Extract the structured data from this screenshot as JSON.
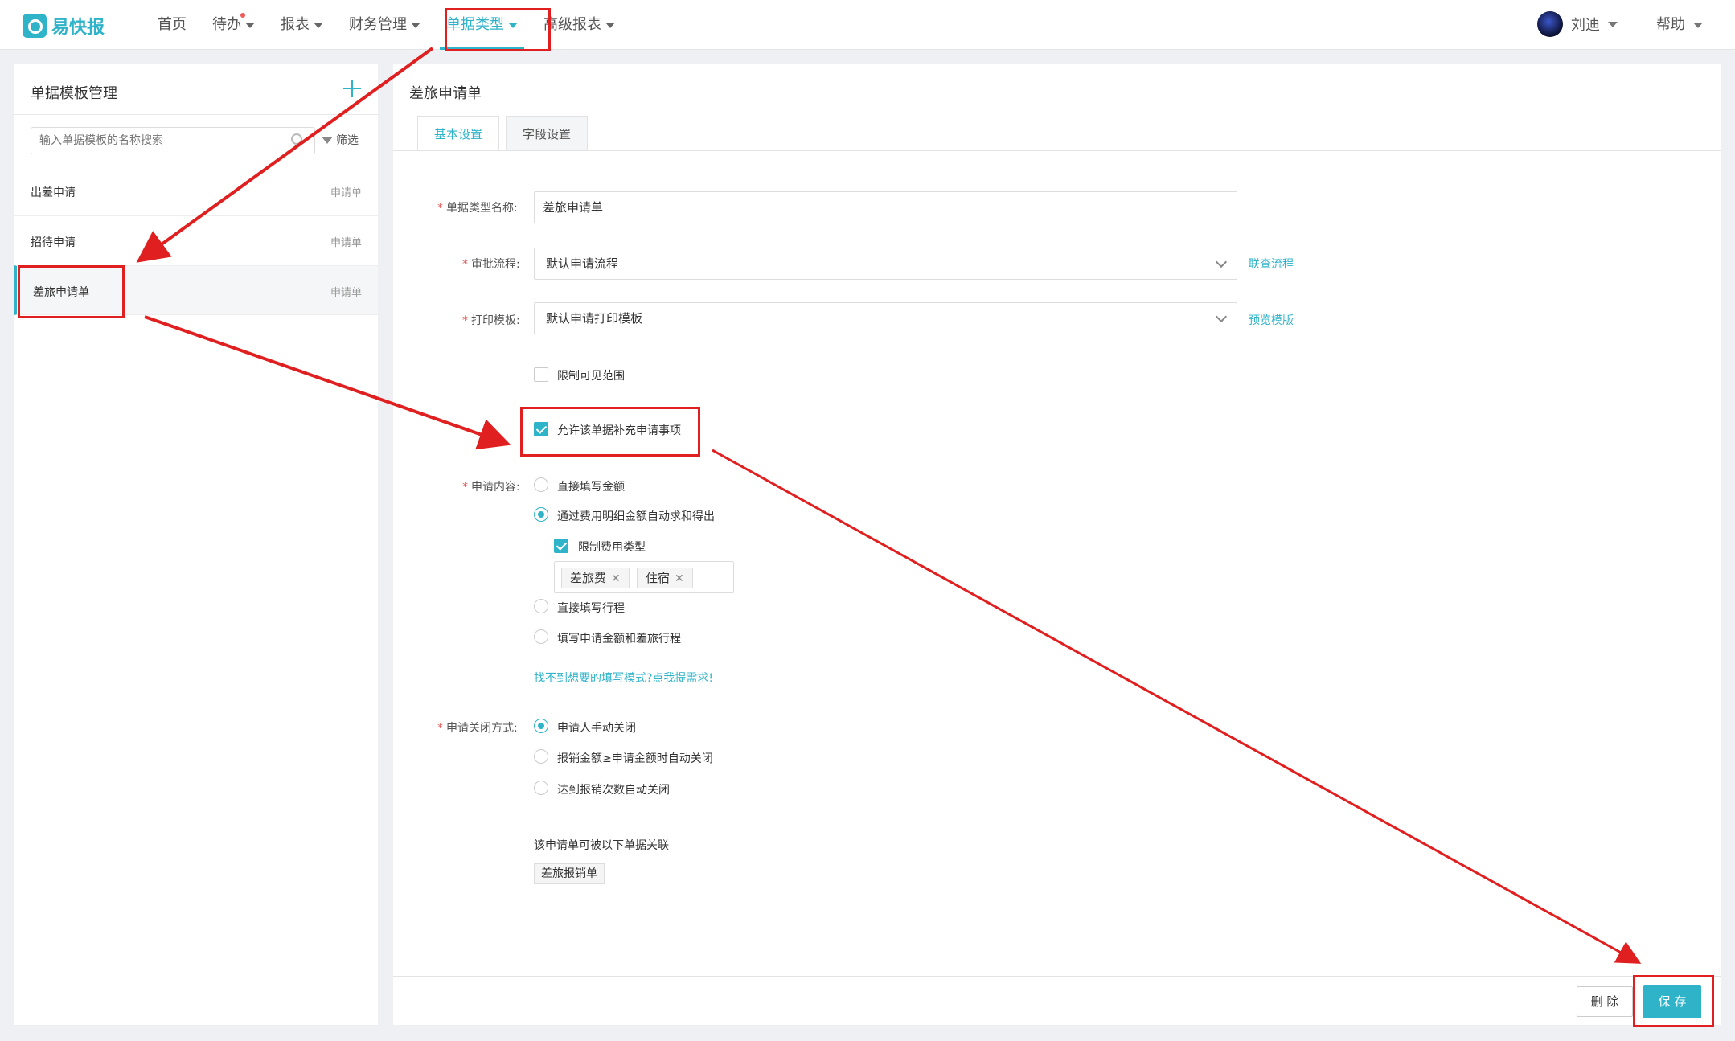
{
  "app": {
    "logo_text": "易快报"
  },
  "nav": {
    "items": [
      {
        "label": "首页"
      },
      {
        "label": "待办"
      },
      {
        "label": "报表"
      },
      {
        "label": "财务管理"
      },
      {
        "label": "单据类型"
      },
      {
        "label": "高级报表"
      }
    ],
    "active": "单据类型"
  },
  "user": {
    "name": "刘迪"
  },
  "help": {
    "label": "帮助"
  },
  "left": {
    "title": "单据模板管理",
    "search_placeholder": "输入单据模板的名称搜索",
    "filter_label": "筛选",
    "items": [
      {
        "name": "出差申请",
        "type": "申请单"
      },
      {
        "name": "招待申请",
        "type": "申请单"
      },
      {
        "name": "差旅申请单",
        "type": "申请单"
      }
    ]
  },
  "right": {
    "title": "差旅申请单",
    "tabs": [
      {
        "label": "基本设置"
      },
      {
        "label": "字段设置"
      }
    ],
    "form": {
      "name_label": "单据类型名称:",
      "name_value": "差旅申请单",
      "flow_label": "审批流程:",
      "flow_value": "默认申请流程",
      "flow_link": "联查流程",
      "print_label": "打印模板:",
      "print_value": "默认申请打印模板",
      "print_link": "预览模版",
      "limit_visible": "限制可见范围",
      "allow_supplement": "允许该单据补充申请事项",
      "content_label": "申请内容:",
      "content_options": [
        "直接填写金额",
        "通过费用明细金额自动求和得出",
        "直接填写行程",
        "填写申请金额和差旅行程"
      ],
      "content_selected": "通过费用明细金额自动求和得出",
      "limit_fee_type": "限制费用类型",
      "fee_tags": [
        "差旅费",
        "住宿"
      ],
      "help_link": "找不到想要的填写模式?点我提需求!",
      "close_label": "申请关闭方式:",
      "close_options": [
        "申请人手动关闭",
        "报销金额≥申请金额时自动关闭",
        "达到报销次数自动关闭"
      ],
      "close_selected": "申请人手动关闭",
      "relation_label": "该申请单可被以下单据关联",
      "relation_chip": "差旅报销单"
    },
    "buttons": {
      "delete": "删 除",
      "save": "保 存"
    }
  },
  "colors": {
    "accent": "#2fb3c9",
    "annotation": "#e02020"
  }
}
